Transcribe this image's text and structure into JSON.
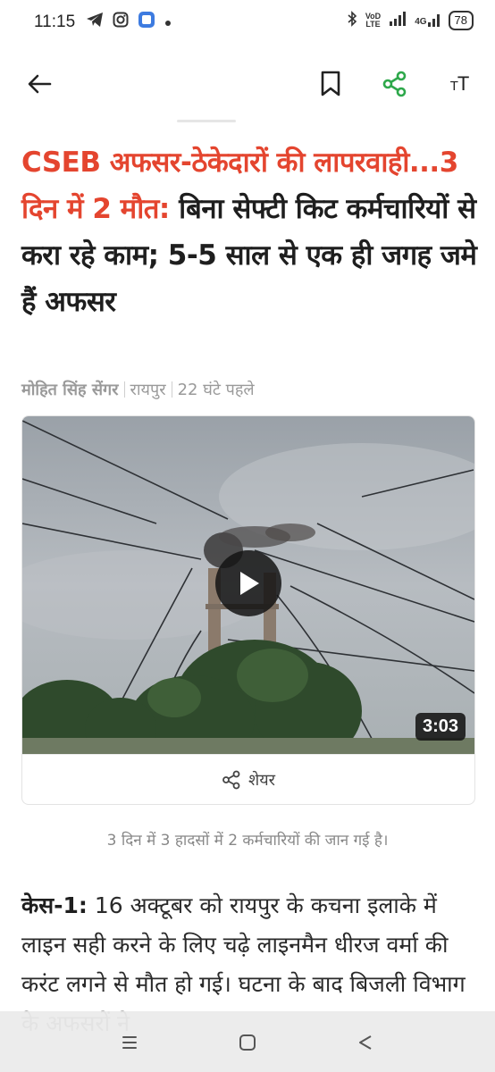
{
  "status_bar": {
    "time": "11:15",
    "battery": "78",
    "lte_top": "VoD",
    "lte_bottom": "LTE",
    "network": "4G",
    "icons": [
      "telegram-icon",
      "instagram-icon",
      "app-icon",
      "dot-icon",
      "bluetooth-icon",
      "signal-icon",
      "wifi-icon"
    ]
  },
  "toolbar": {
    "font_size_label_small": "T",
    "font_size_label_large": "T",
    "accent_color": "#2ea84b"
  },
  "article": {
    "headline_red": "CSEB अफसर-ठेकेदारों की लापरवाही...3 दिन में 2 मौत:",
    "headline_rest": " बिना सेफ्टी किट कर्मचारियों से करा रहे काम; 5-5 साल से एक ही जगह जमे हैं अफसर",
    "headline_red_color": "#e4452f",
    "author": "मोहित सिंह सेंगर",
    "location": "रायपुर",
    "time_ago": "22 घंटे पहले",
    "video": {
      "duration": "3:03",
      "share_label": "शेयर"
    },
    "caption": "3 दिन में 3 हादसों में 2 कर्मचारियों की जान गई है।",
    "body_label": "केस-1:",
    "body_text": " 16 अक्टूबर को रायपुर के कचना इलाके में लाइन सही करने के लिए चढ़े लाइनमैन धीरज वर्मा की करंट लगने से मौत हो गई। घटना के बाद बिजली विभाग के अफसरों ने"
  }
}
